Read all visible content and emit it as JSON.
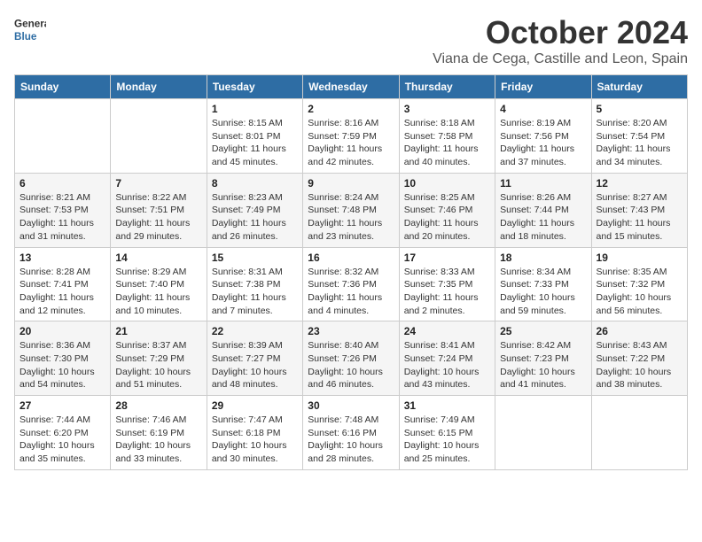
{
  "header": {
    "logo_line1": "General",
    "logo_line2": "Blue",
    "month": "October 2024",
    "location": "Viana de Cega, Castille and Leon, Spain"
  },
  "days_of_week": [
    "Sunday",
    "Monday",
    "Tuesday",
    "Wednesday",
    "Thursday",
    "Friday",
    "Saturday"
  ],
  "weeks": [
    [
      {
        "day": "",
        "info": ""
      },
      {
        "day": "",
        "info": ""
      },
      {
        "day": "1",
        "info": "Sunrise: 8:15 AM\nSunset: 8:01 PM\nDaylight: 11 hours and 45 minutes."
      },
      {
        "day": "2",
        "info": "Sunrise: 8:16 AM\nSunset: 7:59 PM\nDaylight: 11 hours and 42 minutes."
      },
      {
        "day": "3",
        "info": "Sunrise: 8:18 AM\nSunset: 7:58 PM\nDaylight: 11 hours and 40 minutes."
      },
      {
        "day": "4",
        "info": "Sunrise: 8:19 AM\nSunset: 7:56 PM\nDaylight: 11 hours and 37 minutes."
      },
      {
        "day": "5",
        "info": "Sunrise: 8:20 AM\nSunset: 7:54 PM\nDaylight: 11 hours and 34 minutes."
      }
    ],
    [
      {
        "day": "6",
        "info": "Sunrise: 8:21 AM\nSunset: 7:53 PM\nDaylight: 11 hours and 31 minutes."
      },
      {
        "day": "7",
        "info": "Sunrise: 8:22 AM\nSunset: 7:51 PM\nDaylight: 11 hours and 29 minutes."
      },
      {
        "day": "8",
        "info": "Sunrise: 8:23 AM\nSunset: 7:49 PM\nDaylight: 11 hours and 26 minutes."
      },
      {
        "day": "9",
        "info": "Sunrise: 8:24 AM\nSunset: 7:48 PM\nDaylight: 11 hours and 23 minutes."
      },
      {
        "day": "10",
        "info": "Sunrise: 8:25 AM\nSunset: 7:46 PM\nDaylight: 11 hours and 20 minutes."
      },
      {
        "day": "11",
        "info": "Sunrise: 8:26 AM\nSunset: 7:44 PM\nDaylight: 11 hours and 18 minutes."
      },
      {
        "day": "12",
        "info": "Sunrise: 8:27 AM\nSunset: 7:43 PM\nDaylight: 11 hours and 15 minutes."
      }
    ],
    [
      {
        "day": "13",
        "info": "Sunrise: 8:28 AM\nSunset: 7:41 PM\nDaylight: 11 hours and 12 minutes."
      },
      {
        "day": "14",
        "info": "Sunrise: 8:29 AM\nSunset: 7:40 PM\nDaylight: 11 hours and 10 minutes."
      },
      {
        "day": "15",
        "info": "Sunrise: 8:31 AM\nSunset: 7:38 PM\nDaylight: 11 hours and 7 minutes."
      },
      {
        "day": "16",
        "info": "Sunrise: 8:32 AM\nSunset: 7:36 PM\nDaylight: 11 hours and 4 minutes."
      },
      {
        "day": "17",
        "info": "Sunrise: 8:33 AM\nSunset: 7:35 PM\nDaylight: 11 hours and 2 minutes."
      },
      {
        "day": "18",
        "info": "Sunrise: 8:34 AM\nSunset: 7:33 PM\nDaylight: 10 hours and 59 minutes."
      },
      {
        "day": "19",
        "info": "Sunrise: 8:35 AM\nSunset: 7:32 PM\nDaylight: 10 hours and 56 minutes."
      }
    ],
    [
      {
        "day": "20",
        "info": "Sunrise: 8:36 AM\nSunset: 7:30 PM\nDaylight: 10 hours and 54 minutes."
      },
      {
        "day": "21",
        "info": "Sunrise: 8:37 AM\nSunset: 7:29 PM\nDaylight: 10 hours and 51 minutes."
      },
      {
        "day": "22",
        "info": "Sunrise: 8:39 AM\nSunset: 7:27 PM\nDaylight: 10 hours and 48 minutes."
      },
      {
        "day": "23",
        "info": "Sunrise: 8:40 AM\nSunset: 7:26 PM\nDaylight: 10 hours and 46 minutes."
      },
      {
        "day": "24",
        "info": "Sunrise: 8:41 AM\nSunset: 7:24 PM\nDaylight: 10 hours and 43 minutes."
      },
      {
        "day": "25",
        "info": "Sunrise: 8:42 AM\nSunset: 7:23 PM\nDaylight: 10 hours and 41 minutes."
      },
      {
        "day": "26",
        "info": "Sunrise: 8:43 AM\nSunset: 7:22 PM\nDaylight: 10 hours and 38 minutes."
      }
    ],
    [
      {
        "day": "27",
        "info": "Sunrise: 7:44 AM\nSunset: 6:20 PM\nDaylight: 10 hours and 35 minutes."
      },
      {
        "day": "28",
        "info": "Sunrise: 7:46 AM\nSunset: 6:19 PM\nDaylight: 10 hours and 33 minutes."
      },
      {
        "day": "29",
        "info": "Sunrise: 7:47 AM\nSunset: 6:18 PM\nDaylight: 10 hours and 30 minutes."
      },
      {
        "day": "30",
        "info": "Sunrise: 7:48 AM\nSunset: 6:16 PM\nDaylight: 10 hours and 28 minutes."
      },
      {
        "day": "31",
        "info": "Sunrise: 7:49 AM\nSunset: 6:15 PM\nDaylight: 10 hours and 25 minutes."
      },
      {
        "day": "",
        "info": ""
      },
      {
        "day": "",
        "info": ""
      }
    ]
  ]
}
